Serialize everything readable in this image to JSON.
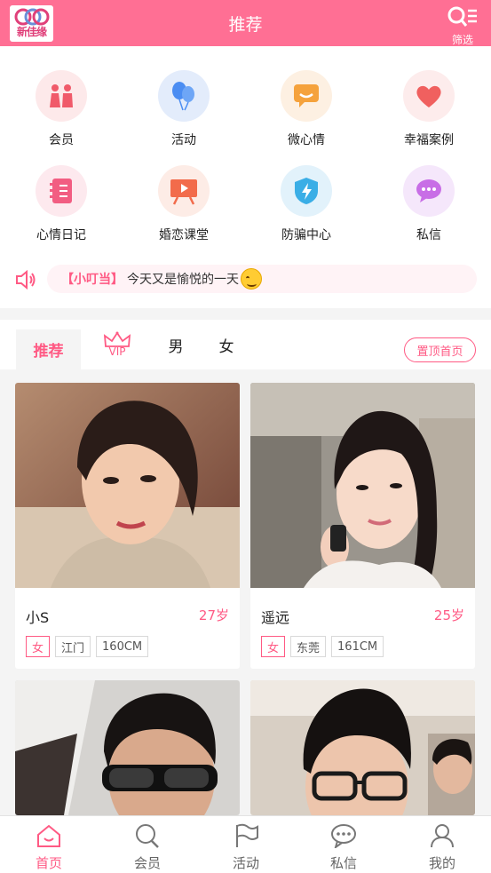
{
  "header": {
    "logo_text": "新佳缘",
    "title": "推荐",
    "filter_label": "筛选"
  },
  "quick_icons": [
    {
      "label": "会员",
      "icon": "couple-icon",
      "bg": "#fde9ea",
      "color": "#f05a6a"
    },
    {
      "label": "活动",
      "icon": "balloon-icon",
      "bg": "#e3ecfb",
      "color": "#4b8df2"
    },
    {
      "label": "微心情",
      "icon": "mood-chat-icon",
      "bg": "#fdf0e2",
      "color": "#f5a23c"
    },
    {
      "label": "幸福案例",
      "icon": "heart-icon",
      "bg": "#fdecec",
      "color": "#f0605f"
    },
    {
      "label": "心情日记",
      "icon": "notebook-icon",
      "bg": "#fde9ee",
      "color": "#f25d82"
    },
    {
      "label": "婚恋课堂",
      "icon": "video-board-icon",
      "bg": "#fdece6",
      "color": "#f26b4b"
    },
    {
      "label": "防骗中心",
      "icon": "shield-icon",
      "bg": "#e2f2fb",
      "color": "#3aaee6"
    },
    {
      "label": "私信",
      "icon": "message-icon",
      "bg": "#f5e7fb",
      "color": "#c86ee6"
    }
  ],
  "notice": {
    "tag": "【小叮当】",
    "text": "今天又是愉悦的一天"
  },
  "tabs": {
    "recommend": "推荐",
    "vip": "VIP",
    "male": "男",
    "female": "女",
    "pin_button": "置顶首页"
  },
  "cards": [
    {
      "name": "小S",
      "age": "27岁",
      "gender": "女",
      "city": "江门",
      "height": "160CM",
      "photo_bg": "#8a5d4a"
    },
    {
      "name": "遥远",
      "age": "25岁",
      "gender": "女",
      "city": "东莞",
      "height": "161CM",
      "photo_bg": "#a8a29b"
    },
    {
      "name": "",
      "age": "",
      "gender": "",
      "city": "",
      "height": "",
      "photo_bg": "#4a3d38"
    },
    {
      "name": "",
      "age": "",
      "gender": "",
      "city": "",
      "height": "",
      "photo_bg": "#c9bfb4"
    }
  ],
  "bottom_nav": [
    {
      "label": "首页",
      "icon": "home-icon",
      "active": true
    },
    {
      "label": "会员",
      "icon": "search-icon",
      "active": false
    },
    {
      "label": "活动",
      "icon": "flag-icon",
      "active": false
    },
    {
      "label": "私信",
      "icon": "chat-icon",
      "active": false
    },
    {
      "label": "我的",
      "icon": "profile-icon",
      "active": false
    }
  ],
  "colors": {
    "brand": "#ff6f94",
    "accent": "#ff5a84"
  }
}
